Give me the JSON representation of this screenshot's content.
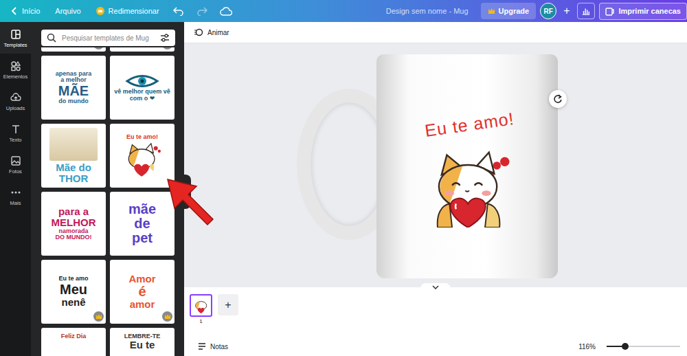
{
  "topbar": {
    "back": "Início",
    "file": "Arquivo",
    "resize": "Redimensionar",
    "title": "Design sem nome - Mug",
    "upgrade": "Upgrade",
    "avatar": "RF",
    "add": "+",
    "print": "Imprimir canecas"
  },
  "sidebar": {
    "items": [
      {
        "label": "Templates",
        "selected": true
      },
      {
        "label": "Elementos",
        "selected": false
      },
      {
        "label": "Uploads",
        "selected": false
      },
      {
        "label": "Texto",
        "selected": false
      },
      {
        "label": "Fotos",
        "selected": false
      },
      {
        "label": "Mais",
        "selected": false
      }
    ]
  },
  "search": {
    "placeholder": "Pesquisar templates de Mug"
  },
  "templates": [
    {
      "kind": "partial",
      "lines": [],
      "color": "#333333",
      "premium": true
    },
    {
      "kind": "partial",
      "lines": [],
      "color": "#333333",
      "premium": true
    },
    {
      "kind": "text",
      "lines": [
        "apenas para",
        "a melhor",
        "MÃE",
        "do mundo"
      ],
      "color": "#2a5d86",
      "premium": false
    },
    {
      "kind": "eye",
      "lines": [
        "vê melhor quem vê",
        "com o ❤"
      ],
      "color": "#17607c",
      "premium": false
    },
    {
      "kind": "photo",
      "lines": [
        "Mãe do",
        "THOR"
      ],
      "color": "#3aa0c6",
      "premium": false
    },
    {
      "kind": "cat",
      "lines": [
        "Eu te amo!"
      ],
      "color": "#e0312b",
      "premium": false
    },
    {
      "kind": "text",
      "lines": [
        "para a",
        "MELHOR",
        "namorada",
        "DO MUNDO!"
      ],
      "color": "#c2185b",
      "premium": false
    },
    {
      "kind": "text",
      "lines": [
        "mãe",
        "de",
        "pet"
      ],
      "color": "#5a3fc4",
      "premium": false
    },
    {
      "kind": "text",
      "lines": [
        "Eu te amo",
        "Meu",
        "nenê"
      ],
      "color": "#1e1e1e",
      "premium": true
    },
    {
      "kind": "text",
      "lines": [
        "Amor",
        "é",
        "amor"
      ],
      "color": "#e8552d",
      "premium": true
    },
    {
      "kind": "top",
      "lines": [
        "Feliz Dia"
      ],
      "color": "#b83227",
      "premium": false
    },
    {
      "kind": "top",
      "lines": [
        "LEMBRE-TE",
        "Eu te"
      ],
      "color": "#333333",
      "premium": false
    }
  ],
  "toolbar": {
    "animate": "Animar"
  },
  "design": {
    "headline": "Eu te amo!"
  },
  "pages": [
    {
      "number": "1",
      "selected": true
    }
  ],
  "add_page": "+",
  "footer": {
    "notes": "Notas",
    "zoom": "116%",
    "zoom_level": 0.25
  }
}
